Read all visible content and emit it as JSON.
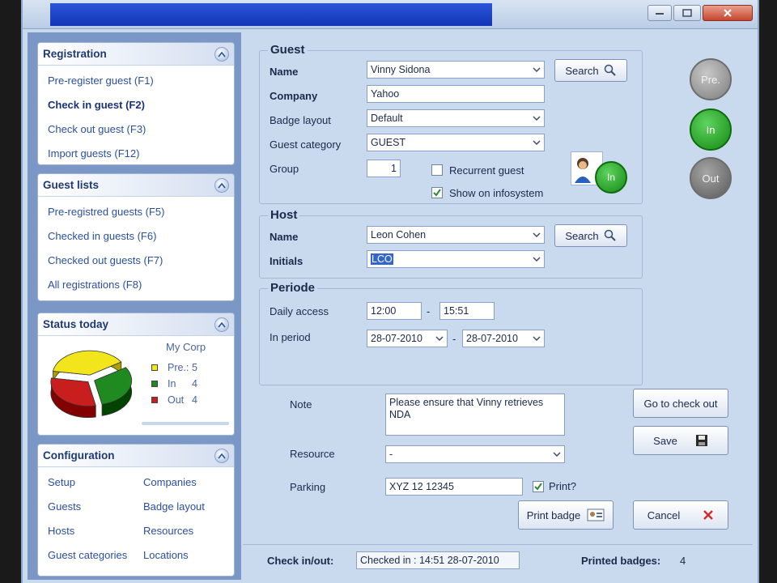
{
  "sidebar": {
    "registration": {
      "title": "Registration",
      "items": [
        {
          "label": "Pre-register guest  (F1)"
        },
        {
          "label": "Check in guest (F2)"
        },
        {
          "label": "Check out guest  (F3)"
        },
        {
          "label": "Import guests (F12)"
        }
      ]
    },
    "guest_lists": {
      "title": "Guest lists",
      "items": [
        {
          "label": "Pre-registred guests (F5)"
        },
        {
          "label": "Checked in guests (F6)"
        },
        {
          "label": "Checked out guests  (F7)"
        },
        {
          "label": "All registrations (F8)"
        }
      ]
    },
    "status_today": {
      "title": "Status today",
      "company": "My Corp",
      "legend": [
        {
          "name": "Pre.:",
          "value": "5",
          "color": "#f2e51c"
        },
        {
          "name": "In",
          "value": "4",
          "color": "#1f8a1f"
        },
        {
          "name": "Out",
          "value": "4",
          "color": "#c81e1e"
        }
      ]
    },
    "configuration": {
      "title": "Configuration",
      "items": [
        {
          "label": "Setup"
        },
        {
          "label": "Companies"
        },
        {
          "label": "Guests"
        },
        {
          "label": "Badge layout"
        },
        {
          "label": "Hosts"
        },
        {
          "label": "Resources"
        },
        {
          "label": "Guest categories"
        },
        {
          "label": "Locations"
        }
      ]
    }
  },
  "chart_data": {
    "type": "pie",
    "categories": [
      "Pre.",
      "In",
      "Out"
    ],
    "values": [
      5,
      4,
      4
    ],
    "colors": [
      "#f2e51c",
      "#1f8a1f",
      "#c81e1e"
    ]
  },
  "guest": {
    "title": "Guest",
    "name_label": "Name",
    "name_value": "Vinny Sidona",
    "company_label": "Company",
    "company_value": "Yahoo",
    "badge_layout_label": "Badge layout",
    "badge_layout_value": "Default",
    "guest_category_label": "Guest category",
    "guest_category_value": "GUEST",
    "group_label": "Group",
    "group_value": "1",
    "recurrent_label": "Recurrent guest",
    "recurrent_checked": false,
    "show_info_label": "Show on infosystem",
    "show_info_checked": true,
    "search_label": "Search"
  },
  "host": {
    "title": "Host",
    "name_label": "Name",
    "name_value": "Leon Cohen",
    "initials_label": "Initials",
    "initials_value": "LCO",
    "search_label": "Search"
  },
  "periode": {
    "title": "Periode",
    "daily_access_label": "Daily access",
    "daily_from": "12:00",
    "daily_sep": "-",
    "daily_to": "15:51",
    "in_period_label": "In period",
    "period_from": "28-07-2010",
    "period_sep": "-",
    "period_to": "28-07-2010"
  },
  "note": {
    "label": "Note",
    "value": "Please ensure that Vinny retrieves NDA"
  },
  "resource": {
    "label": "Resource",
    "value": "-"
  },
  "parking": {
    "label": "Parking",
    "value": "XYZ 12 12345",
    "print_label": "Print?",
    "print_checked": true
  },
  "buttons": {
    "go_checkout": "Go to check out",
    "save": "Save",
    "print_badge": "Print badge",
    "cancel": "Cancel"
  },
  "status_buttons": {
    "pre": "Pre.",
    "in": "In",
    "out": "Out",
    "badge_in": "In"
  },
  "statusbar": {
    "check_label": "Check in/out:",
    "check_value": "Checked in : 14:51 28-07-2010",
    "printed_label": "Printed badges:",
    "printed_value": "4"
  }
}
